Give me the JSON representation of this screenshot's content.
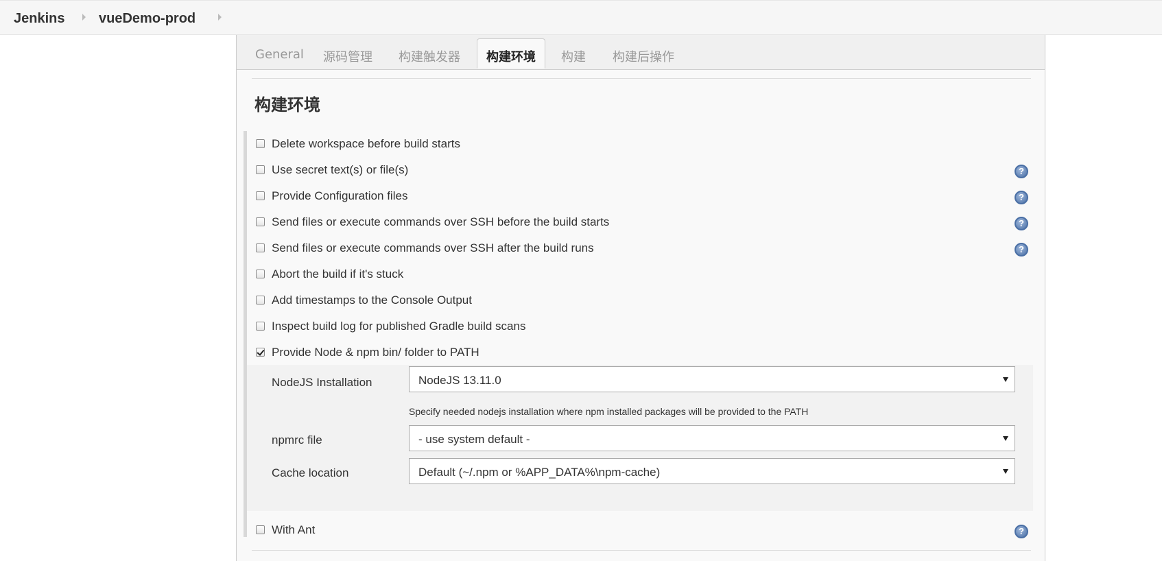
{
  "breadcrumb": {
    "items": [
      "Jenkins",
      "vueDemo-prod"
    ]
  },
  "tabs": [
    "General",
    "源码管理",
    "构建触发器",
    "构建环境",
    "构建",
    "构建后操作"
  ],
  "active_tab_index": 3,
  "section": {
    "title": "构建环境"
  },
  "options": [
    {
      "label": "Delete workspace before build starts",
      "checked": false,
      "help": false
    },
    {
      "label": "Use secret text(s) or file(s)",
      "checked": false,
      "help": true
    },
    {
      "label": "Provide Configuration files",
      "checked": false,
      "help": true
    },
    {
      "label": "Send files or execute commands over SSH before the build starts",
      "checked": false,
      "help": true
    },
    {
      "label": "Send files or execute commands over SSH after the build runs",
      "checked": false,
      "help": true
    },
    {
      "label": "Abort the build if it's stuck",
      "checked": false,
      "help": false
    },
    {
      "label": "Add timestamps to the Console Output",
      "checked": false,
      "help": false
    },
    {
      "label": "Inspect build log for published Gradle build scans",
      "checked": false,
      "help": false
    },
    {
      "label": "Provide Node & npm bin/ folder to PATH",
      "checked": true,
      "help": false
    }
  ],
  "node_config": {
    "installation": {
      "label": "NodeJS Installation",
      "value": "NodeJS 13.11.0",
      "hint": "Specify needed nodejs installation where npm installed packages will be provided to the PATH"
    },
    "npmrc": {
      "label": "npmrc file",
      "value": "- use system default -"
    },
    "cache": {
      "label": "Cache location",
      "value": "Default (~/.npm or %APP_DATA%\\npm-cache)"
    }
  },
  "with_ant": {
    "label": "With Ant",
    "checked": false,
    "help": true
  },
  "help_glyph": "?",
  "icons": {
    "help": "help-icon",
    "breadcrumb_separator": "chevron-right-icon",
    "dropdown": "caret-down-icon"
  }
}
